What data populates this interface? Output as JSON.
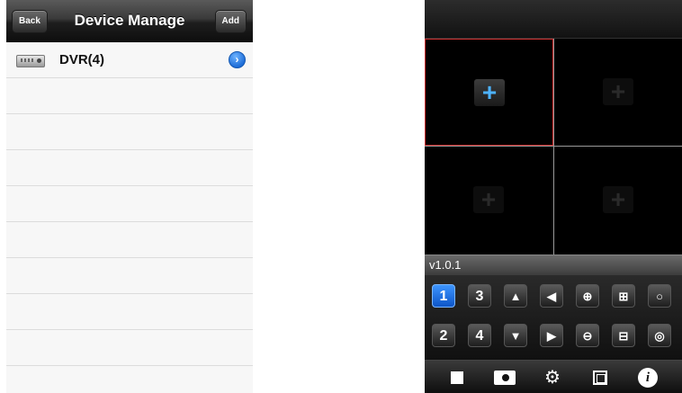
{
  "left_screen": {
    "nav": {
      "back_label": "Back",
      "title": "Device Manage",
      "add_label": "Add"
    },
    "devices": [
      {
        "name": "DVR(4)",
        "icon": "dvr-device-icon"
      }
    ],
    "disclosure_icon": "chevron-right-circle-icon",
    "accent_color": "#1f6ed8"
  },
  "right_screen": {
    "version": "v1.0.1",
    "grid_accent_color": "#d03030",
    "plus_color": "#4db3ff",
    "controls_row1": [
      "1",
      "3",
      "up",
      "left",
      "zoom-in",
      "expand",
      "record-circle"
    ],
    "controls_row2": [
      "2",
      "4",
      "down",
      "right",
      "zoom-out",
      "collapse",
      "settings-circle"
    ],
    "channel_labels": {
      "one": "1",
      "two": "2",
      "three": "3",
      "four": "4"
    },
    "toolbar_icons": [
      "stop-icon",
      "camera-icon",
      "gear-icon",
      "layout-icon",
      "info-icon"
    ],
    "info_glyph": "i"
  }
}
